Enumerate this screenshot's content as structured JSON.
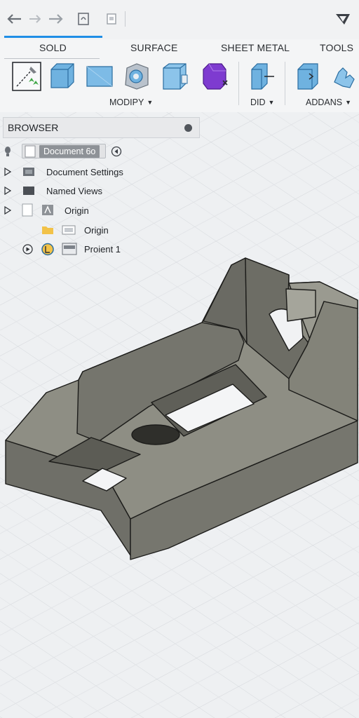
{
  "tabs": [
    "SOLD",
    "SURFACE",
    "SHEET METAL",
    "TOOLS"
  ],
  "groups": {
    "modify": "MODIPY",
    "did": "DID",
    "addans": "ADDANS"
  },
  "browser": {
    "title": "BROWSER",
    "document": "Document 6o",
    "items": [
      "Document Settings",
      "Named Views",
      "Origin",
      "Origin",
      "Proient 1"
    ]
  },
  "colors": {
    "accent": "#1f8ee6",
    "model": "#7a7a72",
    "grid": "#d5d8dc"
  },
  "icons": [
    "undo-icon",
    "redo-gray-icon",
    "redo-icon",
    "save-icon",
    "document-icon",
    "app-logo-icon"
  ]
}
